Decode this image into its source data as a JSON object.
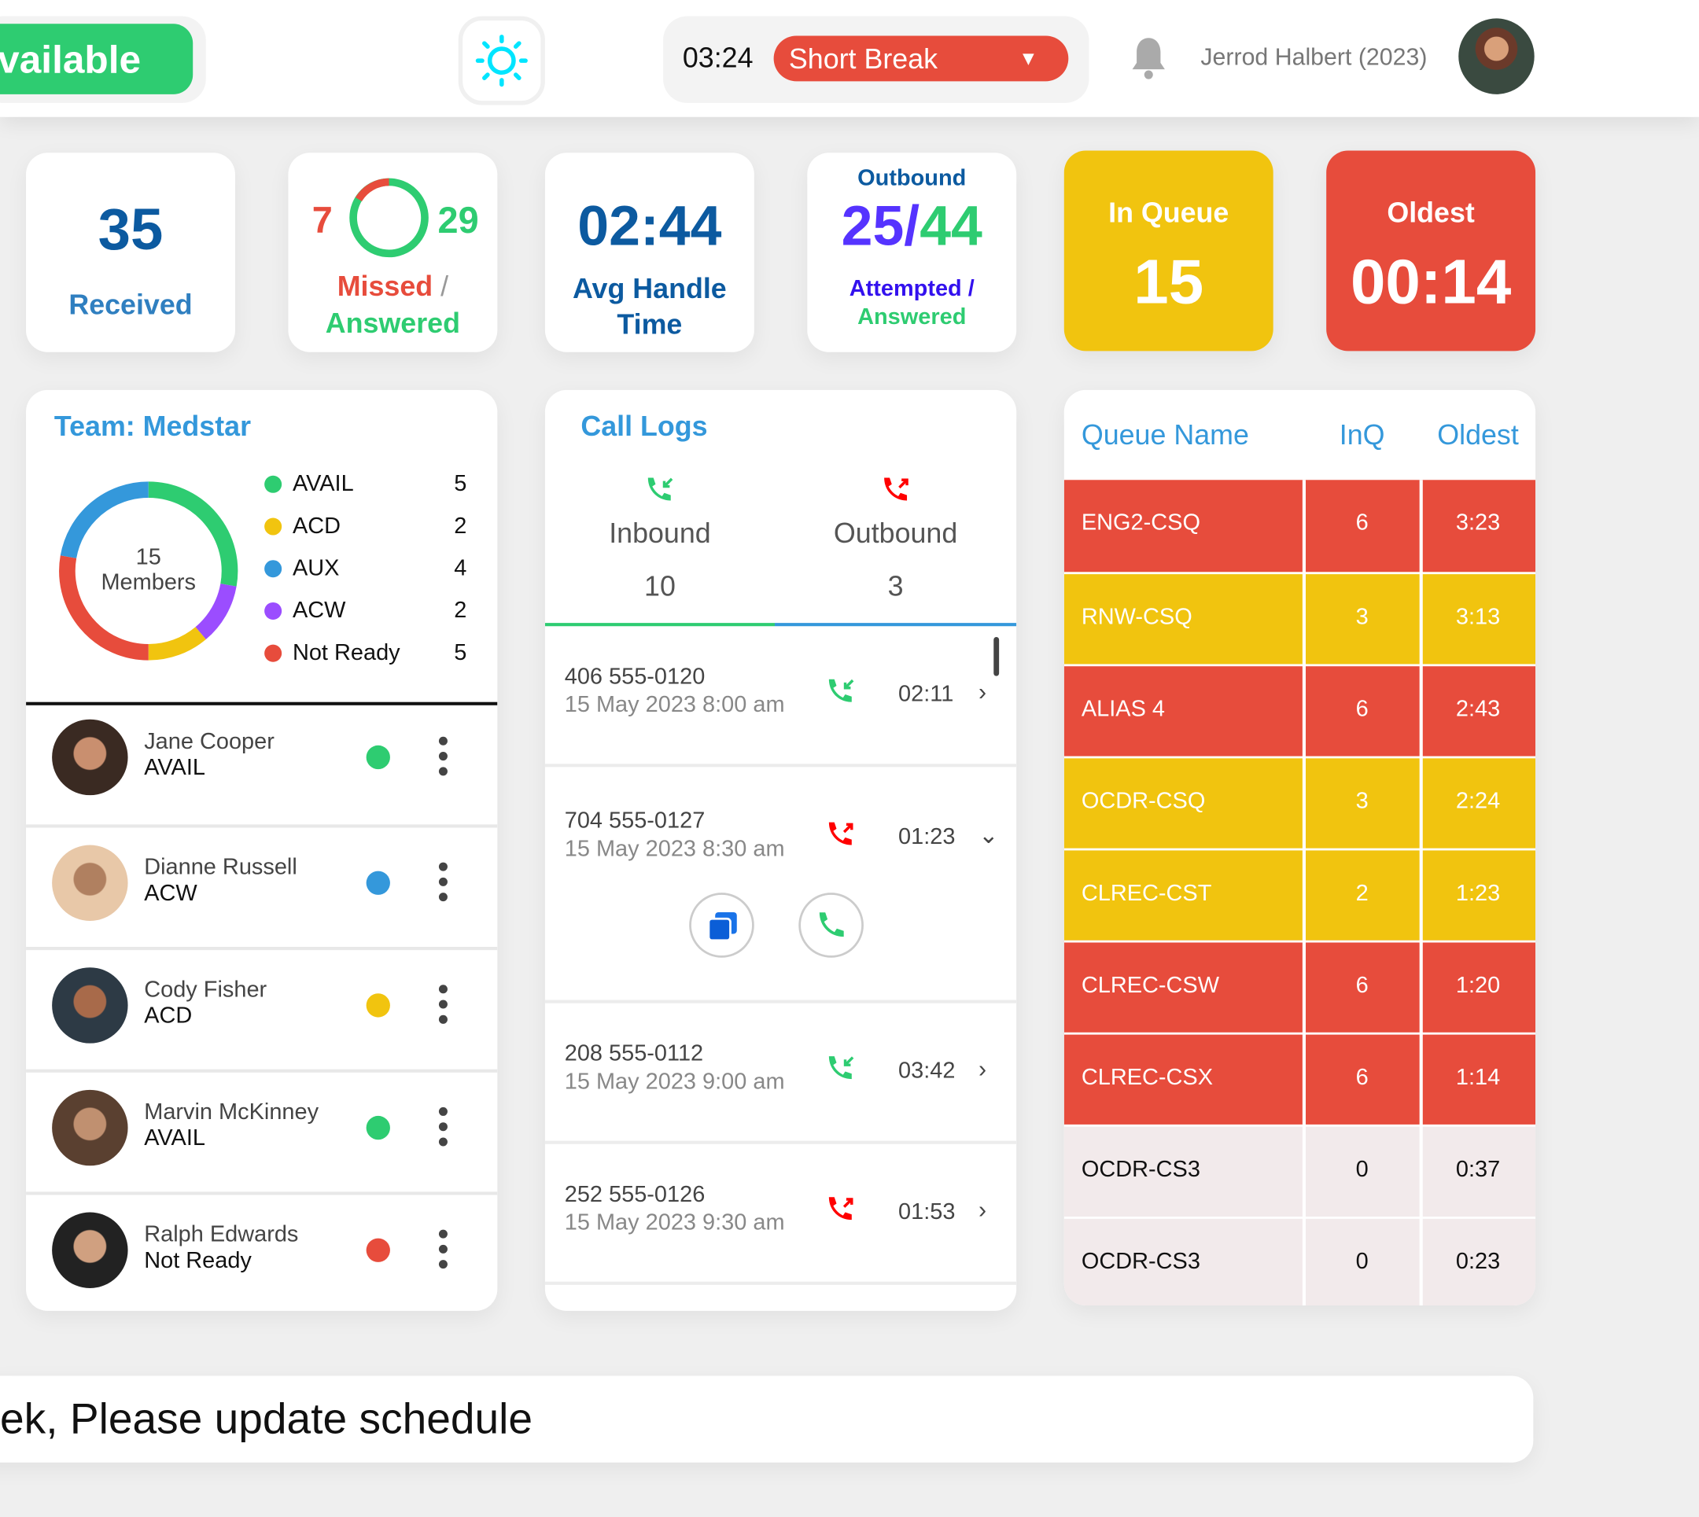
{
  "header": {
    "availability": "Available",
    "theme_icon": "sun-icon",
    "timer": "03:24",
    "status": "Short Break",
    "user_name": "Jerrod Halbert (2023)",
    "notification_icon": "bell-icon"
  },
  "stats": {
    "received": {
      "value": "35",
      "label": "Received"
    },
    "missed_answered": {
      "missed": "7",
      "answered": "29",
      "label_missed": "Missed",
      "sep": " /",
      "label_answered": "Answered"
    },
    "avg_handle": {
      "value": "02:44",
      "label1": "Avg Handle",
      "label2": "Time"
    },
    "outbound": {
      "title": "Outbound",
      "attempted": "25",
      "sep": "/",
      "answered": "44",
      "label_attempted": "Attempted /",
      "label_answered": "Answered"
    },
    "in_queue": {
      "label": "In Queue",
      "value": "15"
    },
    "oldest": {
      "label": "Oldest",
      "value": "00:14"
    }
  },
  "colors": {
    "green": "#2ecc71",
    "yellow": "#f1c40f",
    "blue": "#3498db",
    "purple": "#9b4dff",
    "red": "#e74c3c",
    "navy": "#0c5aa0",
    "queue_gray": "#f2eaeb"
  },
  "team": {
    "title": "Team: Medstar",
    "total": "15",
    "total_label": "Members",
    "legend": [
      {
        "label": "AVAIL",
        "count": "5",
        "color": "#2ecc71"
      },
      {
        "label": "ACD",
        "count": "2",
        "color": "#f1c40f"
      },
      {
        "label": "AUX",
        "count": "4",
        "color": "#3498db"
      },
      {
        "label": "ACW",
        "count": "2",
        "color": "#9b4dff"
      },
      {
        "label": "Not Ready",
        "count": "5",
        "color": "#e74c3c"
      }
    ],
    "members": [
      {
        "name": "Jane Cooper",
        "status": "AVAIL",
        "color": "#2ecc71"
      },
      {
        "name": "Dianne Russell",
        "status": "ACW",
        "color": "#3498db"
      },
      {
        "name": "Cody Fisher",
        "status": "ACD",
        "color": "#f1c40f"
      },
      {
        "name": "Marvin McKinney",
        "status": "AVAIL",
        "color": "#2ecc71"
      },
      {
        "name": "Ralph Edwards",
        "status": "Not Ready",
        "color": "#e74c3c"
      }
    ]
  },
  "call_logs": {
    "title": "Call Logs",
    "inbound_label": "Inbound",
    "inbound_count": "10",
    "outbound_label": "Outbound",
    "outbound_count": "3",
    "calls": [
      {
        "number": "406 555-0120",
        "date": "15 May 2023 8:00 am",
        "direction": "inbound",
        "duration": "02:11",
        "expanded": false
      },
      {
        "number": "704 555-0127",
        "date": "15 May 2023 8:30 am",
        "direction": "outbound",
        "duration": "01:23",
        "expanded": true
      },
      {
        "number": "208 555-0112",
        "date": "15 May 2023 9:00 am",
        "direction": "inbound",
        "duration": "03:42",
        "expanded": false
      },
      {
        "number": "252 555-0126",
        "date": "15 May 2023 9:30 am",
        "direction": "outbound",
        "duration": "01:53",
        "expanded": false
      }
    ]
  },
  "queues": {
    "headers": [
      "Queue Name",
      "InQ",
      "Oldest"
    ],
    "rows": [
      {
        "name": "ENG2-CSQ",
        "inq": "6",
        "oldest": "3:23",
        "level": "red"
      },
      {
        "name": "RNW-CSQ",
        "inq": "3",
        "oldest": "3:13",
        "level": "yellow"
      },
      {
        "name": "ALIAS 4",
        "inq": "6",
        "oldest": "2:43",
        "level": "red"
      },
      {
        "name": "OCDR-CSQ",
        "inq": "3",
        "oldest": "2:24",
        "level": "yellow"
      },
      {
        "name": "CLREC-CST",
        "inq": "2",
        "oldest": "1:23",
        "level": "yellow"
      },
      {
        "name": "CLREC-CSW",
        "inq": "6",
        "oldest": "1:20",
        "level": "red"
      },
      {
        "name": "CLREC-CSX",
        "inq": "6",
        "oldest": "1:14",
        "level": "red"
      },
      {
        "name": "OCDR-CS3",
        "inq": "0",
        "oldest": "0:37",
        "level": "none"
      },
      {
        "name": "OCDR-CS3",
        "inq": "0",
        "oldest": "0:23",
        "level": "none"
      }
    ]
  },
  "banner": {
    "text": "ek, Please update schedule"
  }
}
